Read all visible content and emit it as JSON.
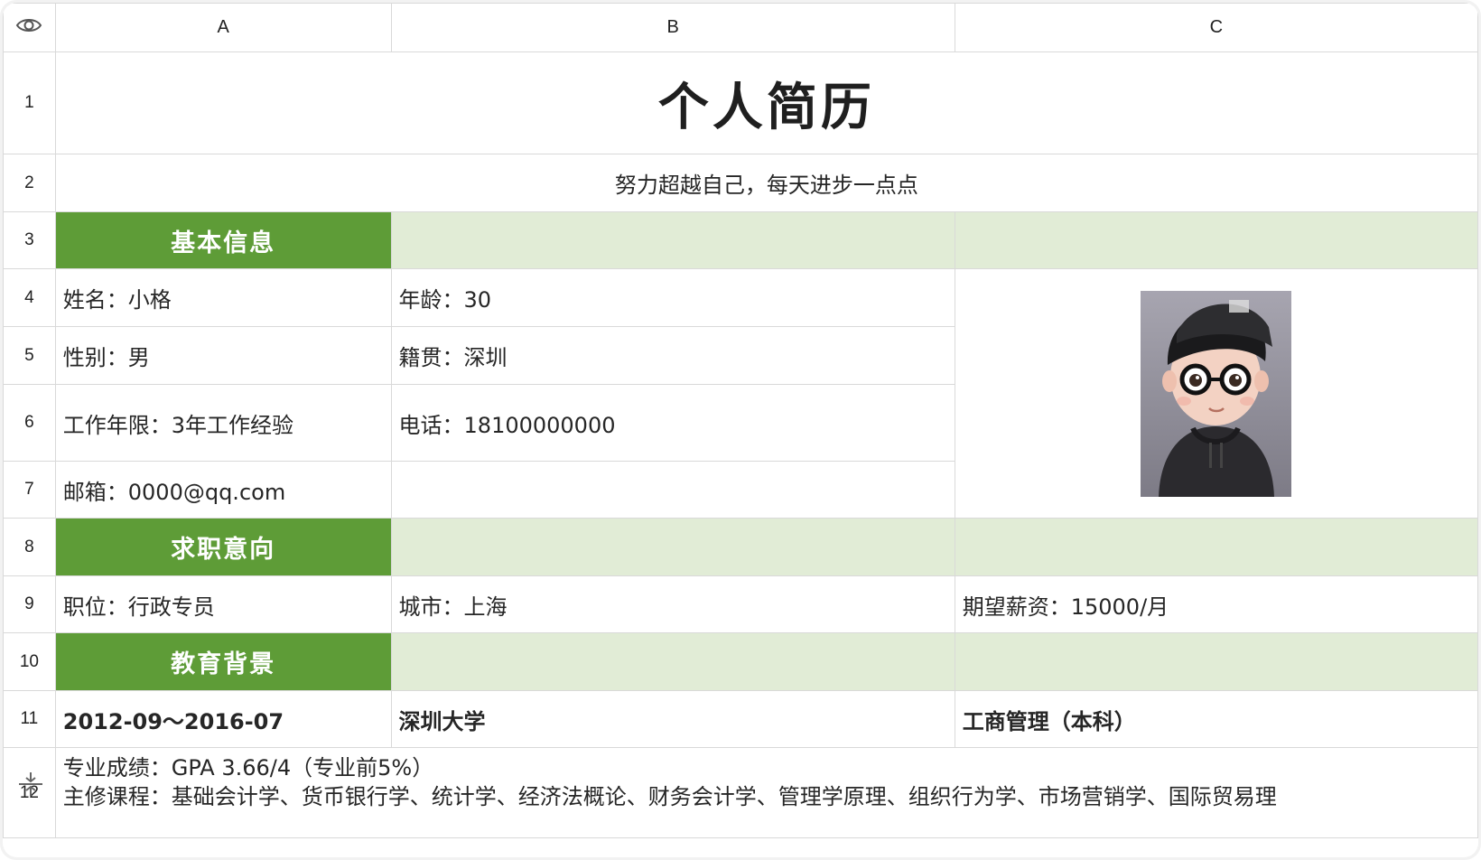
{
  "columns": [
    "A",
    "B",
    "C"
  ],
  "rows": [
    "1",
    "2",
    "3",
    "4",
    "5",
    "6",
    "7",
    "8",
    "9",
    "10",
    "11",
    "12"
  ],
  "cells": {
    "title": "个人简历",
    "motto": "努力超越自己，每天进步一点点",
    "sec_basic": "基本信息",
    "name": "姓名：小格",
    "age": "年龄：30",
    "gender": "性别：男",
    "hometown": "籍贯：深圳",
    "experience": "工作年限：3年工作经验",
    "phone": "电话：18100000000",
    "email": "邮箱：0000@qq.com",
    "sec_intent": "求职意向",
    "position": "职位：行政专员",
    "city": "城市：上海",
    "salary": "期望薪资：15000/月",
    "sec_edu": "教育背景",
    "edu_period": "2012-09～2016-07",
    "edu_school": "深圳大学",
    "edu_major": "工商管理（本科）",
    "edu_gpa": "专业成绩：GPA 3.66/4（专业前5%）",
    "edu_courses": "主修课程：基础会计学、货币银行学、统计学、经济法概论、财务会计学、管理学原理、组织行为学、市场营销学、国际贸易理"
  },
  "icons": {
    "visibility": "eye-icon",
    "row_resize": "row-resize-icon",
    "photo": "avatar-photo"
  },
  "colors": {
    "section_header": "#5e9c37",
    "section_band": "#e1ecd6",
    "grid_line": "#d9d9d9"
  }
}
